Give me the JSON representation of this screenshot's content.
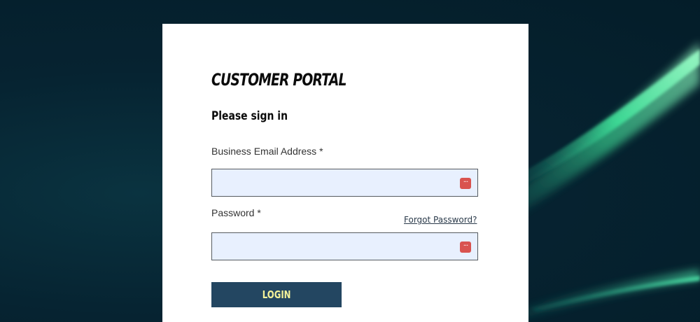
{
  "portal": {
    "title": "CUSTOMER PORTAL",
    "subtitle": "Please sign in"
  },
  "form": {
    "email": {
      "label": "Business Email Address *",
      "value": "",
      "placeholder": "",
      "icon": "password-manager-icon"
    },
    "password": {
      "label": "Password *",
      "value": "",
      "placeholder": "",
      "icon": "password-manager-icon"
    },
    "forgot_password_link": "Forgot Password?",
    "login_button": "LOGIN",
    "autofill_icon_glyph": "···"
  },
  "colors": {
    "background": "#041d29",
    "accent_streak": "#4df0a0",
    "card": "#ffffff",
    "input_fill": "#e8f0fe",
    "button": "#234661",
    "button_text": "#f6f39a",
    "autofill_icon": "#d9534f"
  }
}
